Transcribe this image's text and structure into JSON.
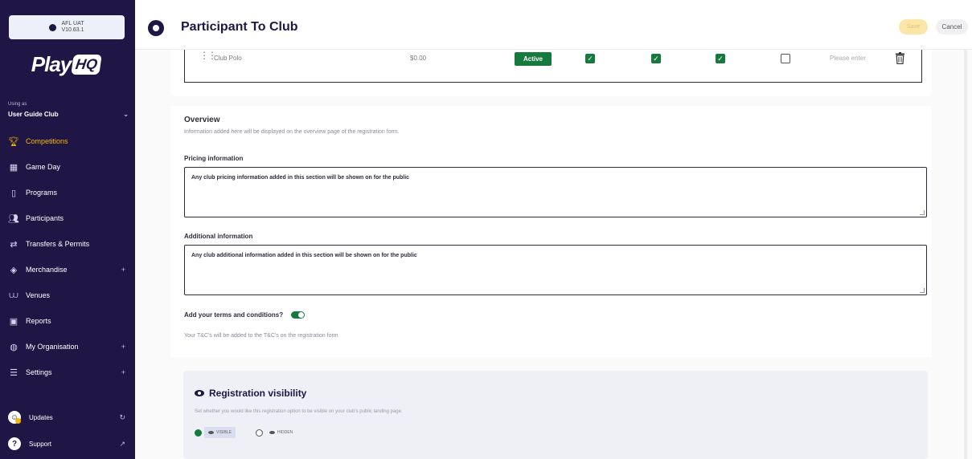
{
  "environment": {
    "name": "AFL UAT",
    "version": "V10.63.1"
  },
  "logo": {
    "play": "Play",
    "hq": "HQ"
  },
  "using_as": {
    "label": "Using as",
    "club": "User Guide Club"
  },
  "nav": [
    {
      "label": "Competitions",
      "icon": "trophy-icon",
      "active": true
    },
    {
      "label": "Game Day",
      "icon": "scoreboard-icon"
    },
    {
      "label": "Programs",
      "icon": "book-icon"
    },
    {
      "label": "Participants",
      "icon": "users-icon"
    },
    {
      "label": "Transfers & Permits",
      "icon": "transfer-icon"
    },
    {
      "label": "Merchandise",
      "icon": "box-icon",
      "expandable": true
    },
    {
      "label": "Venues",
      "icon": "stadium-icon"
    },
    {
      "label": "Reports",
      "icon": "reports-icon"
    },
    {
      "label": "My Organisation",
      "icon": "globe-icon",
      "expandable": true
    },
    {
      "label": "Settings",
      "icon": "sliders-icon",
      "expandable": true
    }
  ],
  "bottom": {
    "updates": "Updates",
    "support": "Support"
  },
  "header": {
    "title": "Participant To Club",
    "save": "Save",
    "cancel": "Cancel"
  },
  "product_row": {
    "name": "Club Polo",
    "price": "$0.00",
    "status": "Active",
    "checkboxes": [
      true,
      true,
      true,
      false
    ],
    "quantity_placeholder": "Please enter"
  },
  "overview": {
    "title": "Overview",
    "description": "Information added here will be displayed on the overview page of the registration form.",
    "pricing_label": "Pricing information",
    "pricing_value": "Any club pricing information added in this section will be shown on for the public",
    "additional_label": "Additional information",
    "additional_value": "Any club additional information added in this section will be shown on for the public",
    "terms_label": "Add your terms and conditions?",
    "terms_enabled": true,
    "terms_description": "Your T&C's will be added to the T&C's on the registration form"
  },
  "visibility": {
    "title": "Registration visibility",
    "description": "Set whether you would like this registration option to be visible on your club's public landing page.",
    "options": [
      {
        "label": "VISIBLE",
        "selected": true
      },
      {
        "label": "HIDDEN",
        "selected": false
      }
    ]
  },
  "colors": {
    "sidebar": "#1f1646",
    "accent": "#f5b800",
    "success": "#167a3f"
  }
}
